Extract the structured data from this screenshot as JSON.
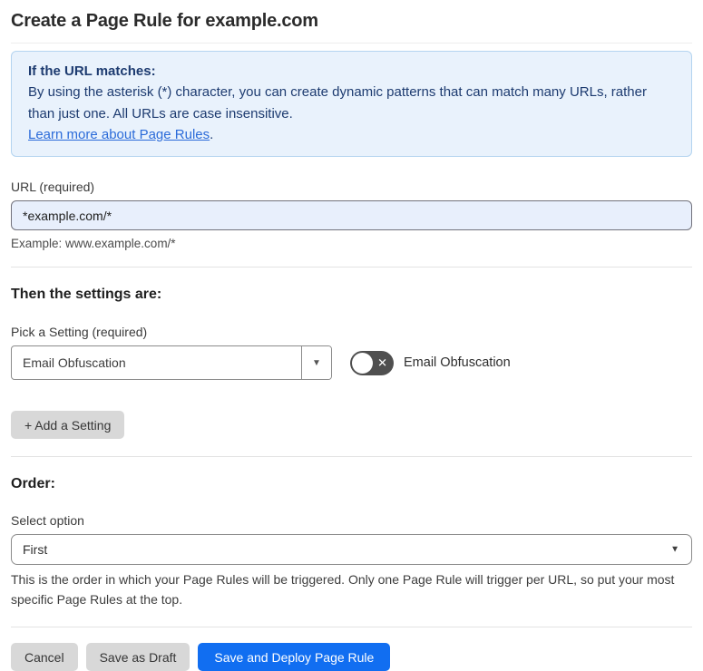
{
  "page": {
    "title": "Create a Page Rule for example.com"
  },
  "info_box": {
    "heading": "If the URL matches:",
    "body": "By using the asterisk (*) character, you can create dynamic patterns that can match many URLs, rather than just one. All URLs are case insensitive.",
    "link_label": "Learn more about Page Rules",
    "link_suffix": "."
  },
  "url_field": {
    "label": "URL (required)",
    "value": "*example.com/*",
    "helper": "Example: www.example.com/*"
  },
  "settings_section": {
    "heading": "Then the settings are:",
    "picker_label": "Pick a Setting (required)",
    "picker_value": "Email Obfuscation",
    "picker_arrow": "▼",
    "toggle": {
      "state": "off",
      "off_glyph": "✕",
      "label": "Email Obfuscation"
    },
    "add_button_label": "+ Add a Setting"
  },
  "order_section": {
    "heading": "Order:",
    "select_label": "Select option",
    "select_value": "First",
    "select_arrow": "▼",
    "helper": "This is the order in which your Page Rules will be triggered. Only one Page Rule will trigger per URL, so put your most specific Page Rules at the top."
  },
  "footer": {
    "cancel_label": "Cancel",
    "save_draft_label": "Save as Draft",
    "save_deploy_label": "Save and Deploy Page Rule"
  },
  "colors": {
    "accent_blue": "#116ef1",
    "info_box_bg": "#e9f2fc",
    "info_box_border": "#b4d4f0",
    "info_text": "#1d3b70",
    "link_blue": "#2b6bd9",
    "url_input_bg": "#e8effc",
    "toggle_off_bg": "#4f4f4f",
    "gray_button_bg": "#d8d8d8"
  }
}
